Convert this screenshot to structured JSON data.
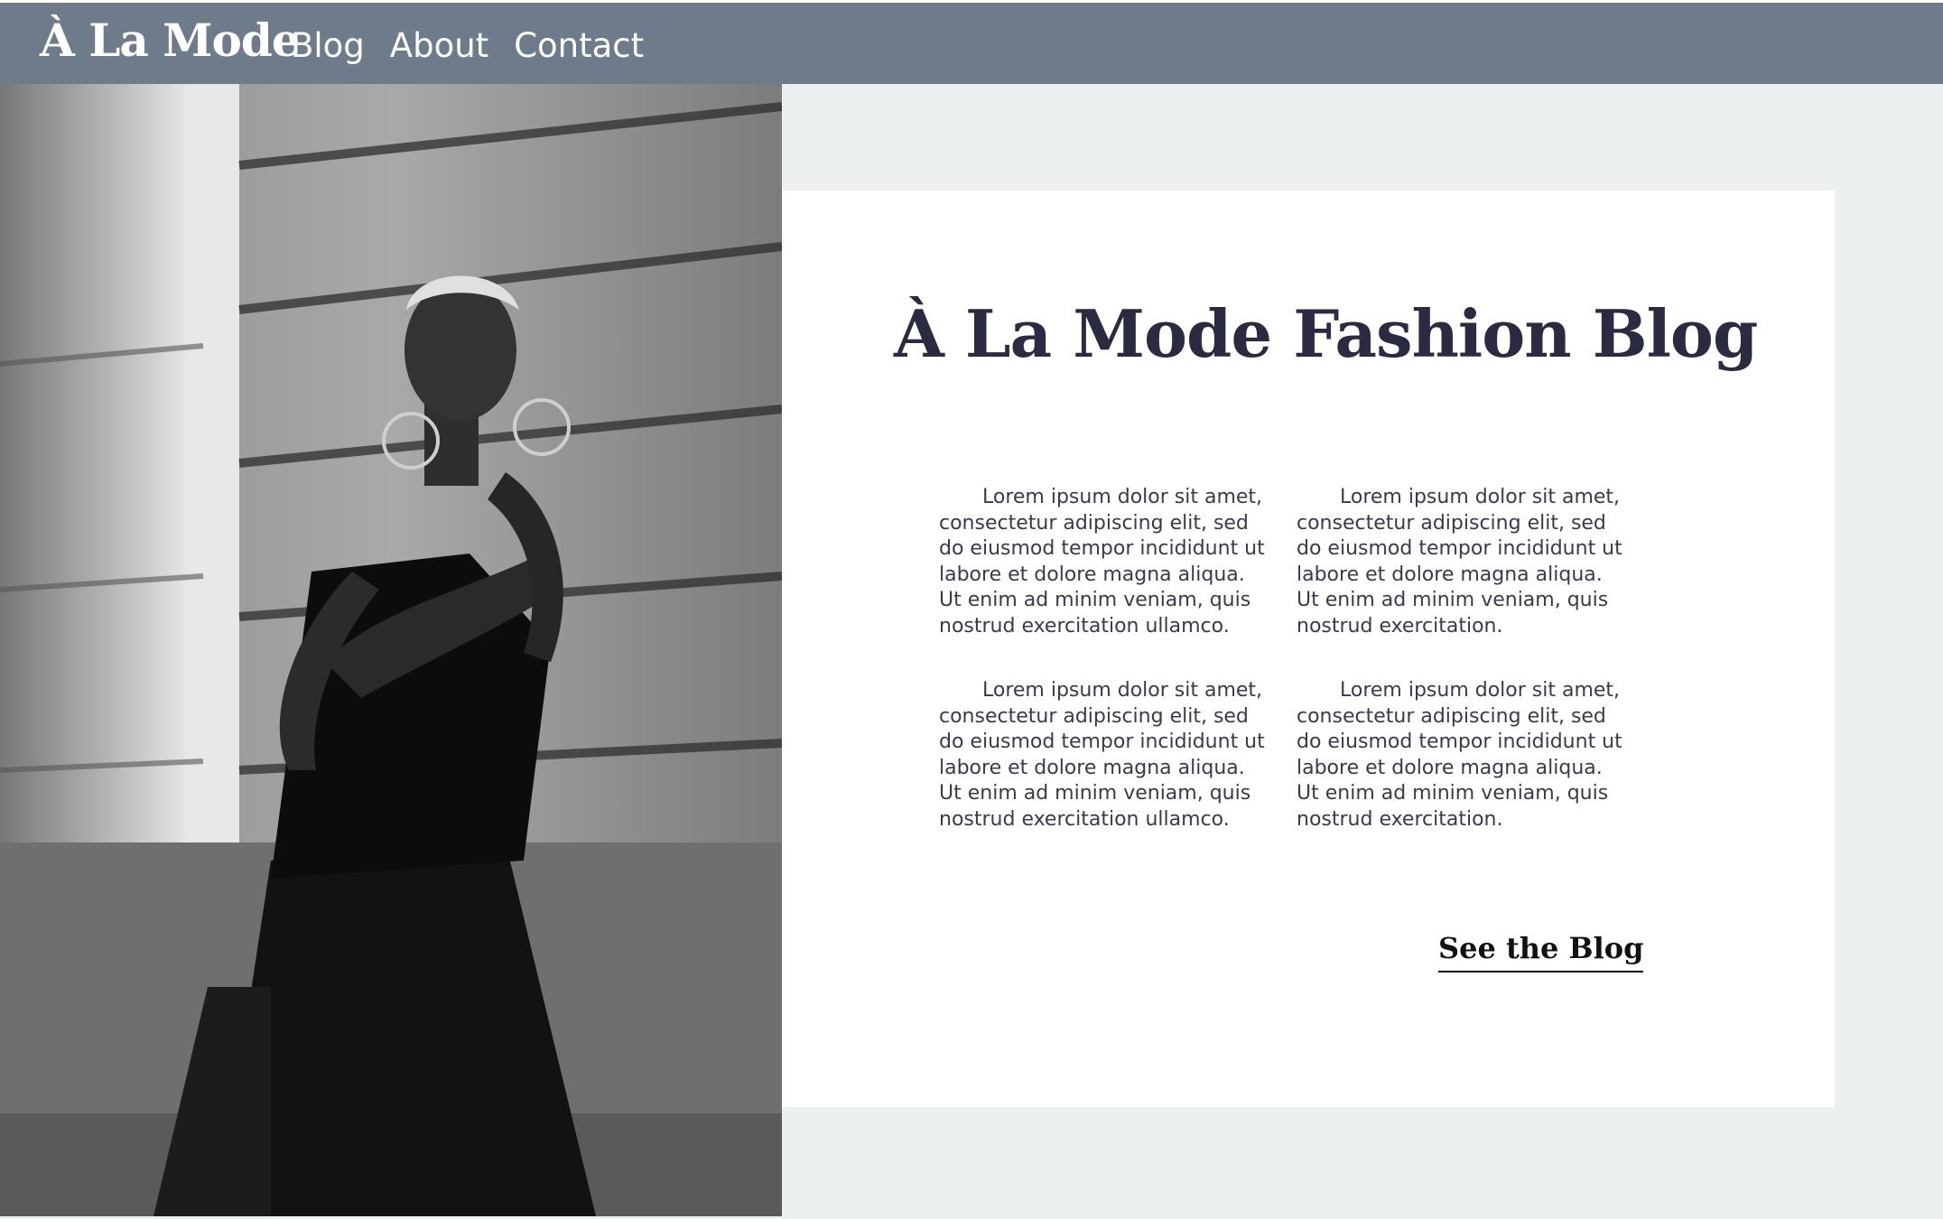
{
  "nav": {
    "brand": "À La Mode",
    "links": [
      {
        "label": "Blog"
      },
      {
        "label": "About"
      },
      {
        "label": "Contact"
      }
    ]
  },
  "hero": {
    "title": "À La Mode Fashion Blog",
    "paragraphs": [
      "Lorem ipsum dolor sit amet, consectetur adipiscing elit, sed do eiusmod tempor incididunt ut labore et dolore magna aliqua. Ut enim ad minim veniam, quis nostrud exercitation ullamco.",
      "Lorem ipsum dolor sit amet, consectetur adipiscing elit, sed do eiusmod tempor incididunt ut labore et dolore magna aliqua. Ut enim ad minim veniam, quis nostrud exercitation.",
      "Lorem ipsum dolor sit amet, consectetur adipiscing elit, sed do eiusmod tempor incididunt ut labore et dolore magna aliqua. Ut enim ad minim veniam, quis nostrud exercitation ullamco.",
      "Lorem ipsum dolor sit amet, consectetur adipiscing elit, sed do eiusmod tempor incididunt ut labore et dolore magna aliqua. Ut enim ad minim veniam, quis nostrud exercitation."
    ],
    "cta_label": "See the Blog"
  },
  "colors": {
    "nav_bg": "#6e7b8b",
    "page_bg": "#ecf0f1",
    "card_bg": "#ffffff",
    "title": "#2a2a40"
  },
  "icons": {
    "photo": "fashion-model-photo"
  }
}
